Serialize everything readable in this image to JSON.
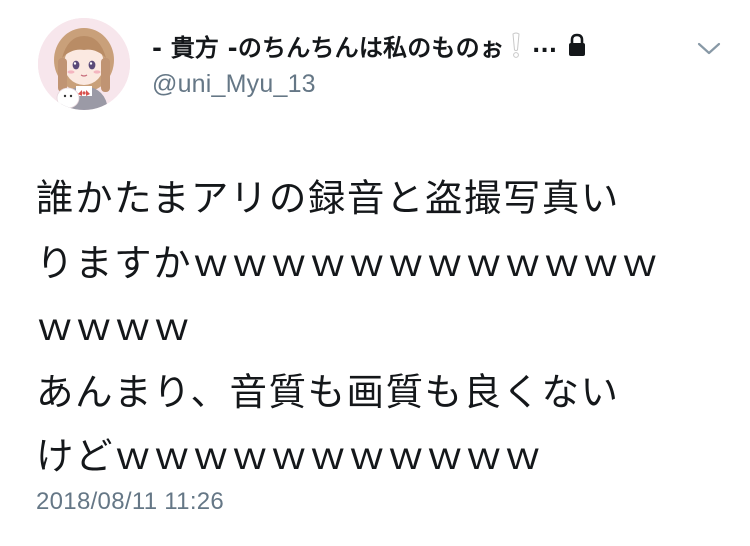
{
  "tweet": {
    "author": {
      "display_name": "- 貴方 -のちんちんは私のものぉ",
      "emoji": "❕",
      "ellipsis": "...",
      "handle": "@uni_Myu_13",
      "avatar_icon": "avatar-illustration",
      "protected_icon": "lock-icon"
    },
    "menu_icon": "chevron-down-icon",
    "text_lines": [
      "誰かたまアリの録音と盗撮写真い",
      "りますかｗｗｗｗｗｗｗｗｗｗｗｗ",
      "ｗｗｗｗ",
      "あんまり、音質も画質も良くない",
      "けどｗｗｗｗｗｗｗｗｗｗｗ"
    ],
    "timestamp": "2018/08/11 11:26"
  },
  "colors": {
    "text_primary": "#14171a",
    "text_secondary": "#657786",
    "background": "#ffffff"
  }
}
